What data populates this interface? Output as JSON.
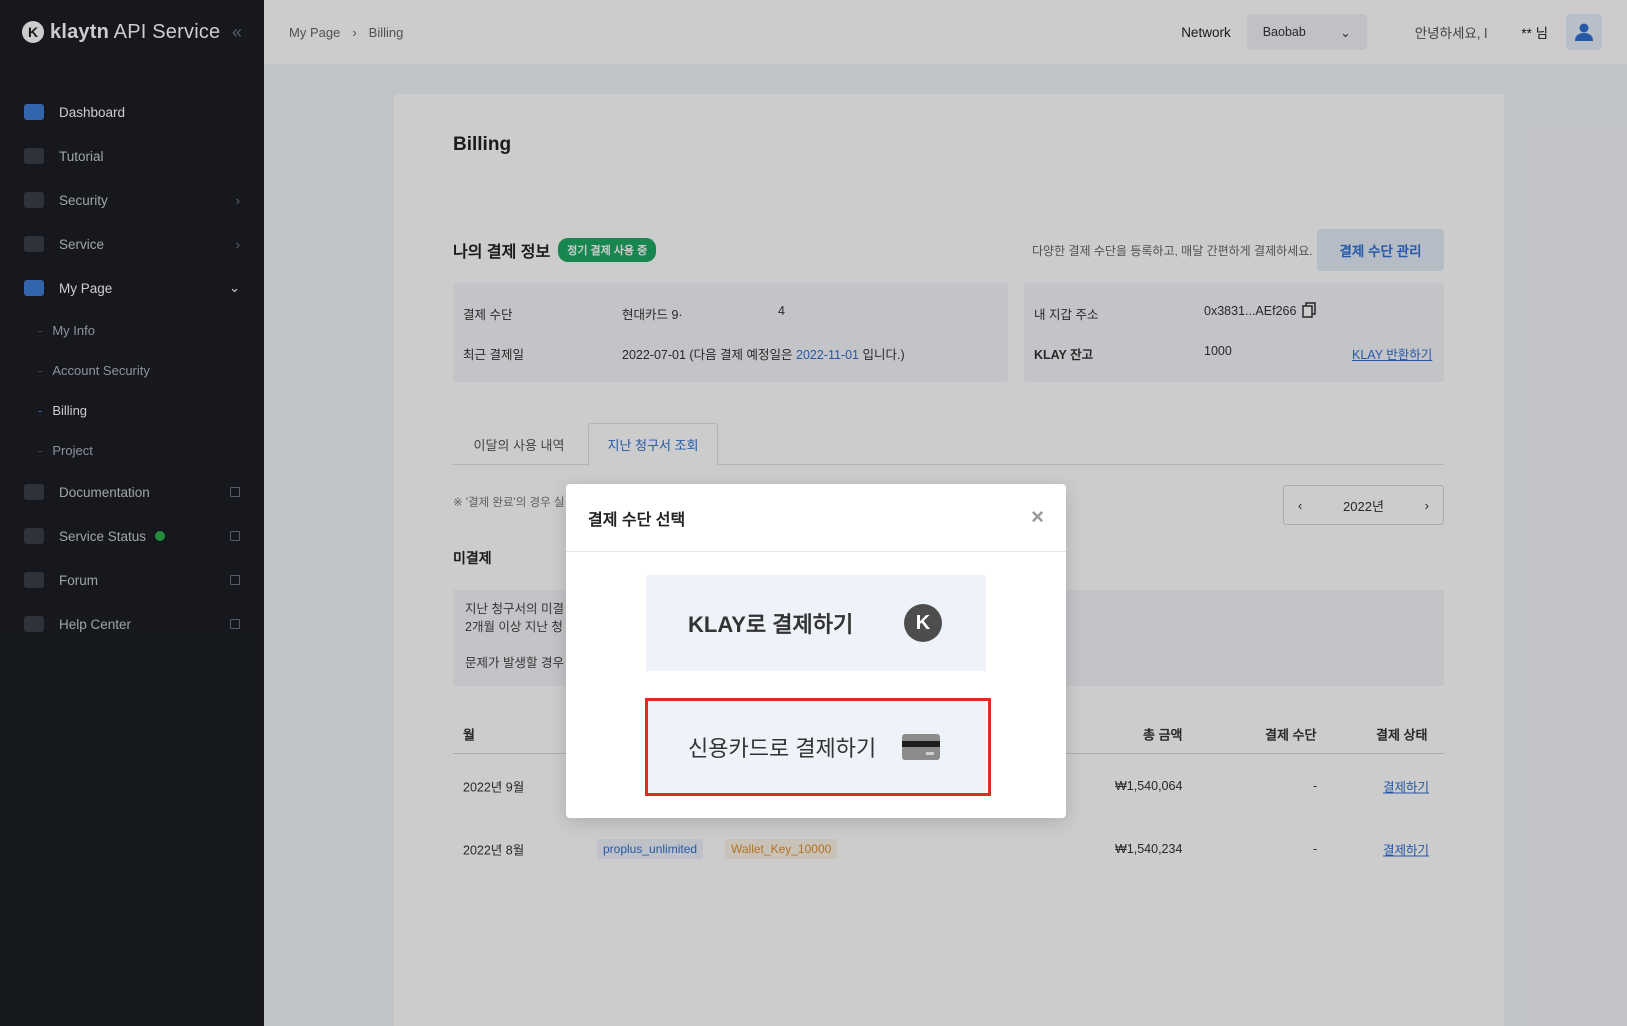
{
  "brand": {
    "name": "klaytn",
    "suffix": "API Service"
  },
  "sidebar": {
    "items": [
      {
        "label": "Dashboard"
      },
      {
        "label": "Tutorial"
      },
      {
        "label": "Security"
      },
      {
        "label": "Service"
      },
      {
        "label": "My Page"
      }
    ],
    "sub_items": [
      {
        "label": "My Info"
      },
      {
        "label": "Account Security"
      },
      {
        "label": "Billing"
      },
      {
        "label": "Project"
      }
    ],
    "bottom_items": [
      {
        "label": "Documentation"
      },
      {
        "label": "Service Status"
      },
      {
        "label": "Forum"
      },
      {
        "label": "Help Center"
      }
    ]
  },
  "header": {
    "breadcrumb": [
      "My Page",
      "Billing"
    ],
    "network_label": "Network",
    "network_value": "Baobab",
    "greeting": "안녕하세요, l",
    "user_name": "** 님"
  },
  "billing": {
    "title": "Billing",
    "payment_info_title": "나의 결제 정보",
    "payment_badge": "정기 결제 사용 중",
    "hint": "다양한 결제 수단을 등록하고, 매달 간편하게 결제하세요.",
    "manage_button": "결제 수단 관리",
    "method_label": "결제 수단",
    "method_value": "현대카드 9·",
    "method_value_end": "4",
    "last_payment_label": "최근 결제일",
    "last_payment_prefix": "2022-07-01 (다음 결제 예정일은 ",
    "last_payment_next": "2022-11-01",
    "last_payment_suffix": " 입니다.)",
    "wallet_label": "내 지갑 주소",
    "wallet_value": "0x3831...AEf266",
    "klay_label": "KLAY 잔고",
    "klay_value": "1000",
    "klay_refund": "KLAY 반환하기",
    "tab_current": "이달의 사용 내역",
    "tab_past": "지난 청구서 조회",
    "note": "※ '결제 완료'의 경우 실",
    "year": "2022년",
    "unpaid_title": "미결제",
    "unpaid_line1": "지난 청구서의 미결",
    "unpaid_line2": "2개월 이상 지난 청",
    "unpaid_line3": "문제가 발생할 경우",
    "table": {
      "headers": {
        "month": "월",
        "total": "총 금액",
        "method": "결제 수단",
        "status": "결제 상태"
      },
      "rows": [
        {
          "month": "2022년 9월",
          "total": "₩1,540,064",
          "method": "-",
          "status": "결제하기"
        },
        {
          "month": "2022년 8월",
          "plan": "proplus_unlimited",
          "addon": "Wallet_Key_10000",
          "total": "₩1,540,234",
          "method": "-",
          "status": "결제하기"
        }
      ]
    }
  },
  "modal": {
    "title": "결제 수단 선택",
    "klay_option": "KLAY로 결제하기",
    "card_option": "신용카드로 결제하기"
  },
  "colors": {
    "accent": "#2f6fd1",
    "badge_green": "#1ea863",
    "highlight_red": "#e32a1f",
    "sidebar_bg": "#1c1f26"
  }
}
